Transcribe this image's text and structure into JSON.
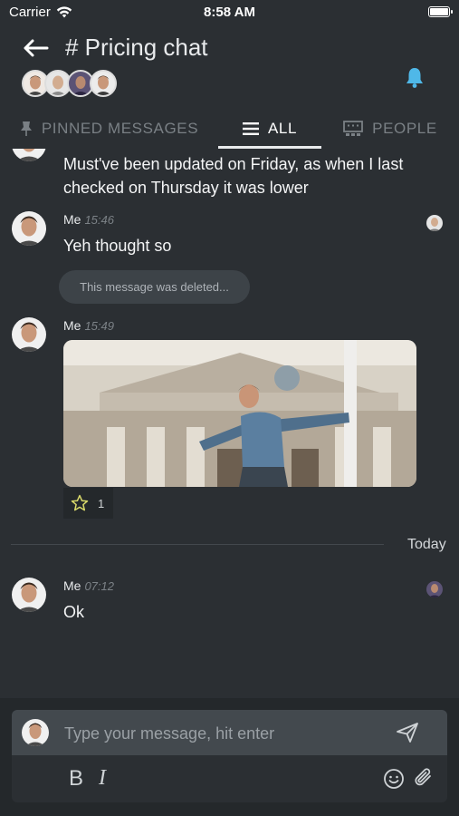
{
  "status": {
    "carrier": "Carrier",
    "time": "8:58 AM"
  },
  "header": {
    "title": "# Pricing chat"
  },
  "tabs": [
    {
      "label": "PINNED MESSAGES",
      "icon": "pin-icon"
    },
    {
      "label": "ALL",
      "icon": "list-icon"
    },
    {
      "label": "PEOPLE",
      "icon": "people-icon"
    }
  ],
  "messages": [
    {
      "text": "Must've been updated on Friday, as when I last checked on Thursday it was lower"
    },
    {
      "name": "Me",
      "time": "15:46",
      "text": "Yeh thought so"
    },
    {
      "deleted": "This message was deleted..."
    },
    {
      "name": "Me",
      "time": "15:49",
      "reaction_count": "1"
    },
    {
      "name": "Me",
      "time": "07:12",
      "text": "Ok"
    }
  ],
  "day_separator": "Today",
  "composer": {
    "placeholder": "Type your message, hit enter",
    "bold_label": "B",
    "italic_label": "I"
  },
  "colors": {
    "background": "#2b2f33",
    "accent": "#4fb8e8",
    "composer_bg": "#24282b"
  }
}
